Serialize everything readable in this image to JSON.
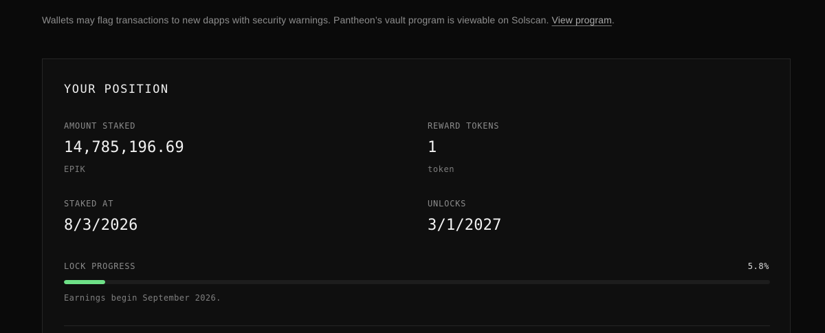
{
  "notice": {
    "text": "Wallets may flag transactions to new dapps with security warnings. Pantheon’s vault program is viewable on Solscan. ",
    "link_label": "View program",
    "suffix": "."
  },
  "position": {
    "title": "YOUR POSITION",
    "amount_staked": {
      "label": "AMOUNT STAKED",
      "value": "14,785,196.69",
      "unit": "EPIK"
    },
    "reward_tokens": {
      "label": "REWARD TOKENS",
      "value": "1",
      "unit": "token"
    },
    "staked_at": {
      "label": "STAKED AT",
      "value": "8/3/2026"
    },
    "unlocks": {
      "label": "UNLOCKS",
      "value": "3/1/2027"
    },
    "lock_progress": {
      "label": "LOCK PROGRESS",
      "percent_text": "5.8%",
      "percent": 5.8,
      "note": "Earnings begin September 2026."
    }
  },
  "colors": {
    "background": "#0a0a0a",
    "card": "#0f0f0f",
    "progress_fill": "#6ee087",
    "progress_track": "#1d1d1d"
  }
}
